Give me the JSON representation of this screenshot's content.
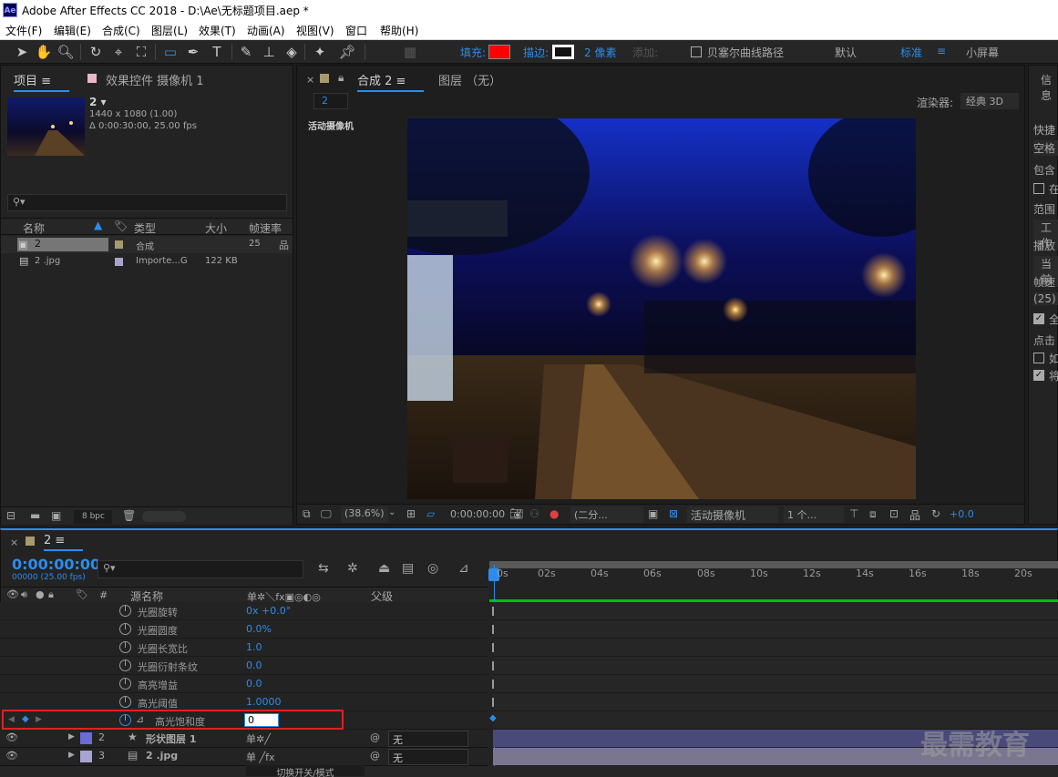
{
  "window": {
    "title": "Adobe After Effects CC 2018 - D:\\Ae\\无标题项目.aep *",
    "logo": "Ae"
  },
  "menu": [
    "文件(F)",
    "编辑(E)",
    "合成(C)",
    "图层(L)",
    "效果(T)",
    "动画(A)",
    "视图(V)",
    "窗口",
    "帮助(H)"
  ],
  "toolbar": {
    "fill_label": "填充:",
    "stroke_label": "描边:",
    "stroke_width": "2 像素",
    "add_label": "添加:",
    "bezier_label": "贝塞尔曲线路径",
    "workspace_default": "默认",
    "workspace_standard": "标准",
    "workspace_small": "小屏幕",
    "fill_color": "#ff0000"
  },
  "project_panel": {
    "tab_project": "项目",
    "tab_effects": "效果控件 摄像机 1",
    "comp_name": "2 ▾",
    "comp_size": "1440 x 1080 (1.00)",
    "comp_duration": "Δ 0:00:30:00, 25.00 fps",
    "search_placeholder": "",
    "columns": {
      "name": "名称",
      "type": "类型",
      "size": "大小",
      "fps": "帧速率"
    },
    "items": [
      {
        "name": "2",
        "type": "合成",
        "size": "",
        "fps": "25",
        "label_color": "#a89a6f"
      },
      {
        "name": "2 .jpg",
        "type": "Importe...G",
        "size": "122 KB",
        "fps": "",
        "label_color": "#a9a3cf"
      }
    ],
    "bpc": "8 bpc"
  },
  "composition_panel": {
    "tab_comp": "合成 2",
    "tab_layer": "图层 （无）",
    "breadcrumb": "2",
    "renderer_label": "渲染器:",
    "renderer_value": "经典 3D",
    "active_camera_label": "活动摄像机",
    "zoom": "(38.6%)",
    "timecode": "0:00:00:00",
    "resolution": "(二分...",
    "view": "活动摄像机",
    "views_count": "1 个...",
    "exposure": "+0.0"
  },
  "info_panel": {
    "labels": [
      "信息",
      "快捷",
      "空格",
      "包含",
      "在",
      "范围",
      "工作",
      "播放",
      "当前",
      "帧速",
      "(25)",
      "全",
      "点击",
      "如",
      "将"
    ]
  },
  "timeline": {
    "tab": "2",
    "timecode": "0:00:00:00",
    "frame_info": "00000 (25.00 fps)",
    "search_placeholder": "",
    "col_source": "源名称",
    "col_parent": "父级",
    "switch_icons": "单✲＼fx▣◎◐◎",
    "ruler": [
      "0s",
      "02s",
      "04s",
      "06s",
      "08s",
      "10s",
      "12s",
      "14s",
      "16s",
      "18s",
      "20s"
    ],
    "properties": [
      {
        "name": "光圈旋转",
        "value": "0x +0.0°"
      },
      {
        "name": "光圈圆度",
        "value": "0.0%"
      },
      {
        "name": "光圈长宽比",
        "value": "1.0"
      },
      {
        "name": "光圈衍射条纹",
        "value": "0.0"
      },
      {
        "name": "高亮增益",
        "value": "0.0"
      },
      {
        "name": "高光阈值",
        "value": "1.0000"
      }
    ],
    "highlight_property": {
      "name": "高光饱和度",
      "value": "0"
    },
    "layers": [
      {
        "index": "2",
        "name": "形状图层 1",
        "parent": "无",
        "color": "#6b6bd6"
      },
      {
        "index": "3",
        "name": "2 .jpg",
        "parent": "无",
        "color": "#a9a3cf"
      }
    ],
    "bottom_label": "切换开关/模式"
  },
  "watermark": "最需教育"
}
